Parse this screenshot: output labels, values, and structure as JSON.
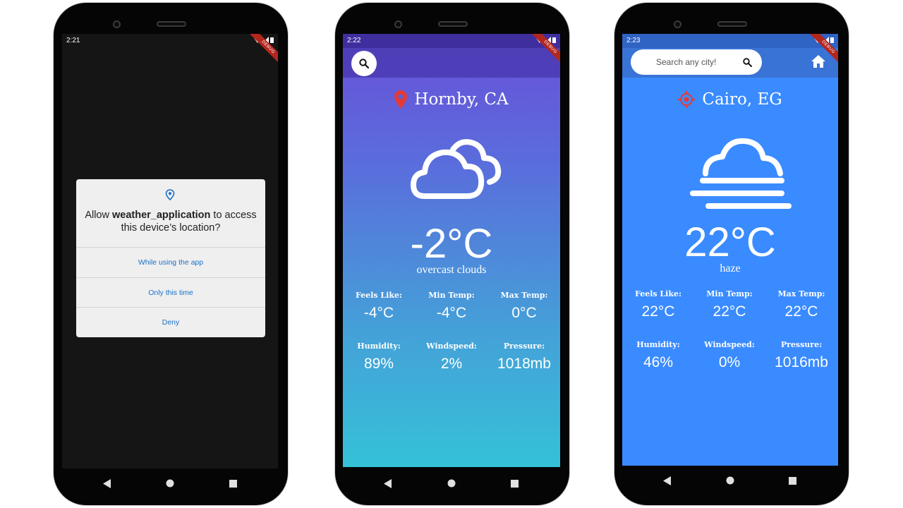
{
  "phone1": {
    "status_time": "2:21",
    "dialog": {
      "question_prefix": "Allow ",
      "app_name": "weather_application",
      "question_suffix": " to access this device’s location?",
      "options": [
        "While using the app",
        "Only this time",
        "Deny"
      ]
    }
  },
  "phone2": {
    "status_time": "2:22",
    "city": "Hornby, CA",
    "temperature": "-2°C",
    "description": "overcast clouds",
    "stats": [
      {
        "label": "Feels Like:",
        "value": "-4°C"
      },
      {
        "label": "Min Temp:",
        "value": "-4°C"
      },
      {
        "label": "Max Temp:",
        "value": "0°C"
      },
      {
        "label": "Humidity:",
        "value": "89%"
      },
      {
        "label": "Windspeed:",
        "value": "2%"
      },
      {
        "label": "Pressure:",
        "value": "1018mb"
      }
    ],
    "icon": "cloud-icon"
  },
  "phone3": {
    "status_time": "2:23",
    "search_placeholder": "Search any city!",
    "city": "Cairo, EG",
    "temperature": "22°C",
    "description": "haze",
    "stats": [
      {
        "label": "Feels Like:",
        "value": "22°C"
      },
      {
        "label": "Min Temp:",
        "value": "22°C"
      },
      {
        "label": "Max Temp:",
        "value": "22°C"
      },
      {
        "label": "Humidity:",
        "value": "46%"
      },
      {
        "label": "Windspeed:",
        "value": "0%"
      },
      {
        "label": "Pressure:",
        "value": "1016mb"
      }
    ],
    "icon": "haze-icon"
  },
  "debug_banner": "DEBUG",
  "colors": {
    "dialog_accent": "#1a6fc9",
    "pin_red": "#e53935",
    "gradient_top": "#6a4fd8",
    "gradient_bottom": "#35c1d8",
    "cairo_bg": "#3a8bff",
    "cairo_bar": "#3a73d6"
  }
}
